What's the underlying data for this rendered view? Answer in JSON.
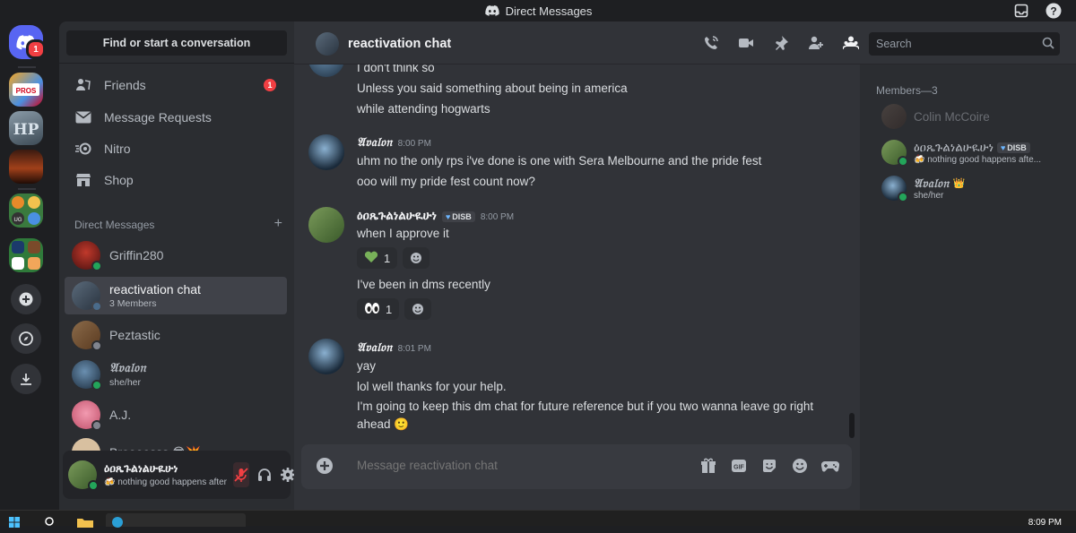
{
  "window": {
    "title": "Direct Messages"
  },
  "rail": {
    "home_badge": "1"
  },
  "sidebar": {
    "search_placeholder": "Find or start a conversation",
    "nav": [
      {
        "label": "Friends",
        "badge": "1",
        "icon": "friends-icon"
      },
      {
        "label": "Message Requests",
        "icon": "envelope-icon"
      },
      {
        "label": "Nitro",
        "icon": "nitro-icon"
      },
      {
        "label": "Shop",
        "icon": "shop-icon"
      }
    ],
    "dm_header": "Direct Messages",
    "dms": [
      {
        "name": "Griffin280",
        "sub": "",
        "status": "online"
      },
      {
        "name": "reactivation chat",
        "sub": "3 Members",
        "status": "",
        "active": true
      },
      {
        "name": "Peztastic",
        "sub": "",
        "status": "offline"
      },
      {
        "name": "𝔄𝔳𝔞𝔩𝔬𝔫",
        "sub": "she/her",
        "status": "online"
      },
      {
        "name": "A.J.",
        "sub": "",
        "status": "offline"
      },
      {
        "name": "Broooosss 😎💥",
        "sub": "",
        "status": ""
      }
    ],
    "user": {
      "name": "ዕዐጼጉልነልሁዪሁነ",
      "status": "🍻 nothing good happens after ..."
    }
  },
  "chat": {
    "title": "reactivation chat",
    "search_placeholder": "Search",
    "composer_placeholder": "Message reactivation chat",
    "messages": {
      "cont1": "I don't think so",
      "cont2": "Unless you said something about being in america",
      "cont3": "while attending hogwarts",
      "m1_author": "𝔄𝔳𝔞𝔩𝔬𝔫",
      "m1_time": "8:00 PM",
      "m1_l1": "uhm no the only rps i've done is one with Sera Melbourne and the pride fest",
      "m1_l2": "ooo will my pride fest count now?",
      "m2_author": "ዕዐጼጉልነልሁዪሁነ",
      "m2_tag": "DISB",
      "m2_time": "8:00 PM",
      "m2_l1": "when I approve it",
      "m2_react1_count": "1",
      "m2_l2": "I've been in dms recently",
      "m2_react2_count": "1",
      "m3_author": "𝔄𝔳𝔞𝔩𝔬𝔫",
      "m3_time": "8:01 PM",
      "m3_l1": "yay",
      "m3_l2": "lol well thanks for your help.",
      "m3_l3": "I'm going to keep this dm chat for future reference but if you two wanna leave go right",
      "m3_l4": "ahead 🙂"
    }
  },
  "members": {
    "header": "Members—3",
    "list": [
      {
        "name": "Colin McCoire",
        "sub": "",
        "status": "offline"
      },
      {
        "name": "ዕዐጼጉልነልሁዪሁነ",
        "tag": "DISB",
        "sub": "🍻 nothing good happens afte...",
        "status": "online"
      },
      {
        "name": "𝔄𝔳𝔞𝔩𝔬𝔫",
        "crown": "👑",
        "sub": "she/her",
        "status": "online"
      }
    ]
  },
  "taskbar": {
    "clock": "8:09 PM"
  },
  "colors": {
    "accent": "#5865f2",
    "online": "#23a55a",
    "danger": "#f23f43"
  }
}
